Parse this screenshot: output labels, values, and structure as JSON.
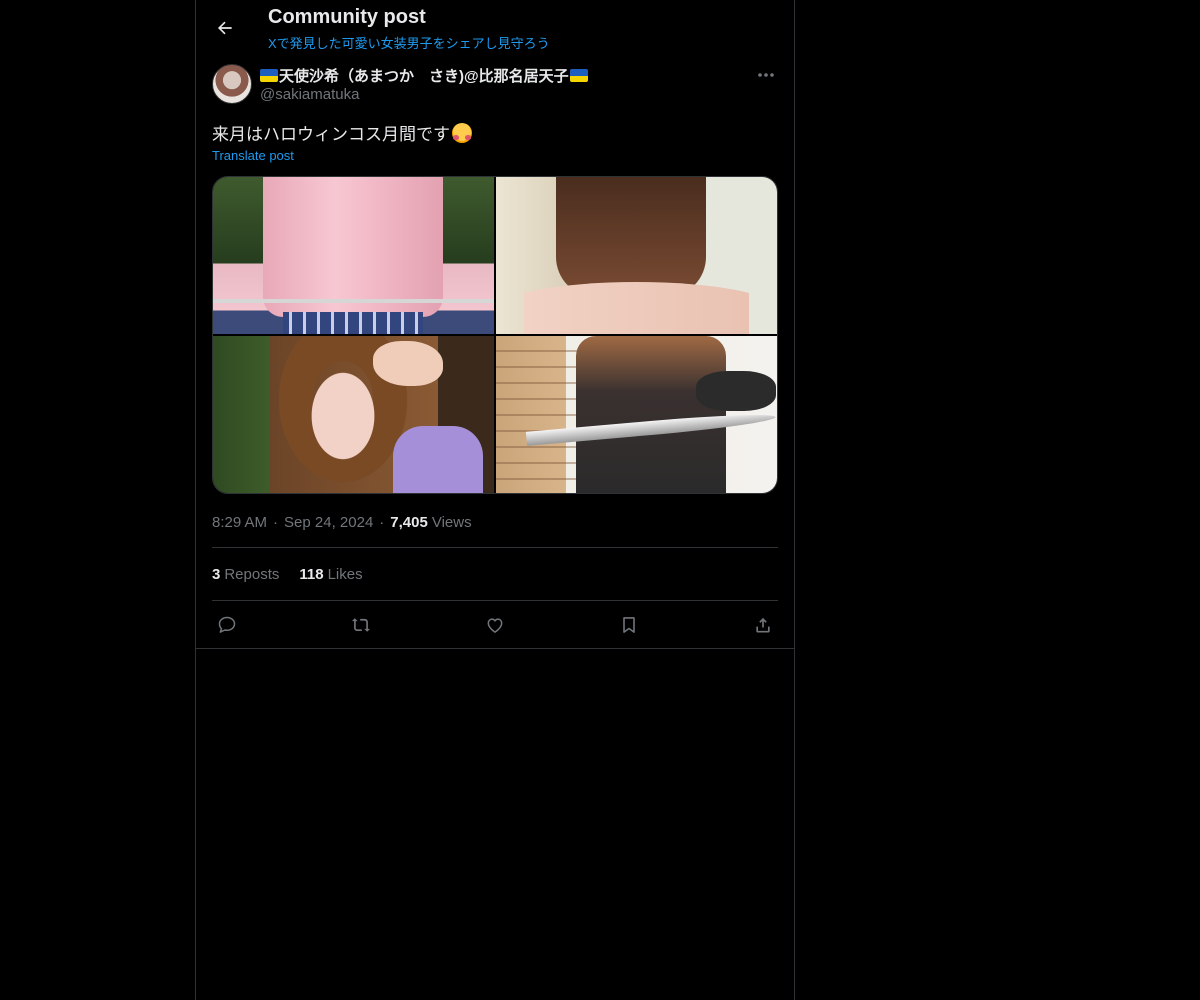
{
  "header": {
    "title": "Community post",
    "subtitle": "Xで発見した可愛い女装男子をシェアし見守ろう",
    "back_icon": "arrow-left-icon"
  },
  "post": {
    "author": {
      "display_name": "天使沙希（あまつか　さき)@比那名居天子",
      "handle": "@sakiamatuka",
      "flag_icon": "ukraine-flag-icon"
    },
    "text": "来月はハロウィンコス月間です",
    "emoji_icon": "smiling-face-with-hearts-icon",
    "translate_label": "Translate post",
    "media": [
      {
        "name": "photo-pink-jacket"
      },
      {
        "name": "photo-black-outfit"
      },
      {
        "name": "photo-peace-sign"
      },
      {
        "name": "photo-sword"
      }
    ],
    "meta": {
      "time": "8:29 AM",
      "date": "Sep 24, 2024",
      "views_count": "7,405",
      "views_label": "Views",
      "separator": "·"
    },
    "stats": {
      "reposts_count": "3",
      "reposts_label": "Reposts",
      "likes_count": "118",
      "likes_label": "Likes"
    },
    "actions": [
      "reply-icon",
      "repost-icon",
      "like-icon",
      "bookmark-icon",
      "share-icon"
    ]
  },
  "colors": {
    "background": "#000000",
    "text_primary": "#e7e9ea",
    "text_secondary": "#71767b",
    "accent": "#1d9bf0",
    "border": "#2f3336"
  }
}
